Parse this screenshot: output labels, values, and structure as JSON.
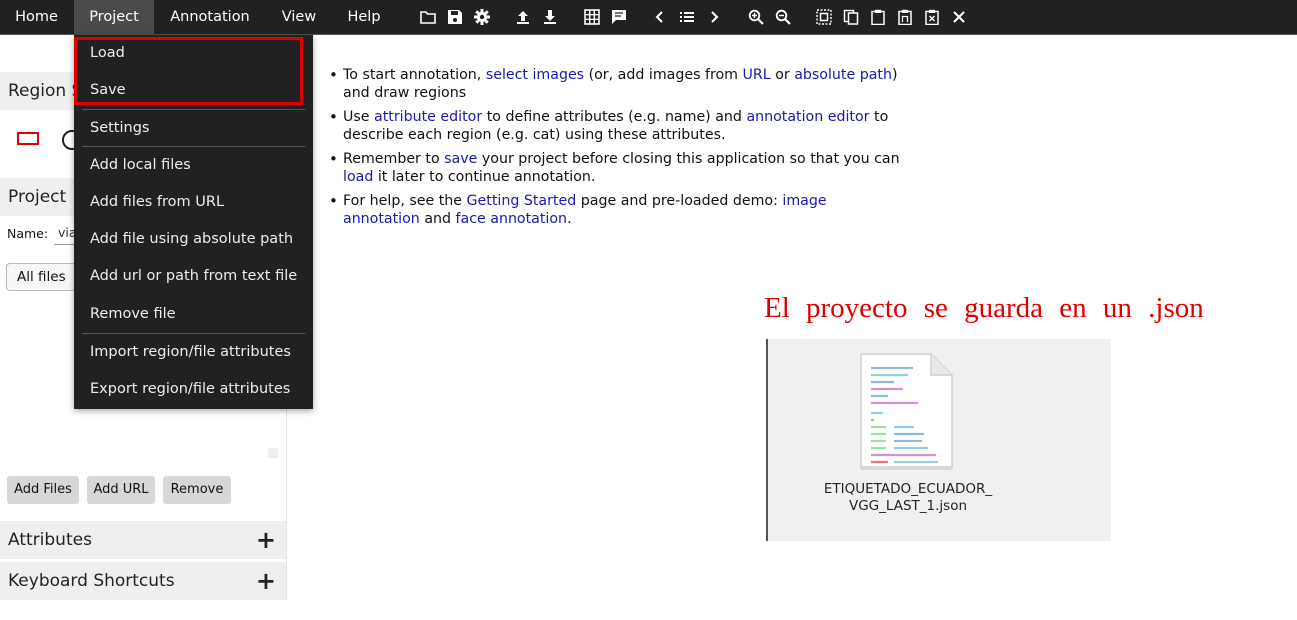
{
  "menubar": {
    "menus": [
      "Home",
      "Project",
      "Annotation",
      "View",
      "Help"
    ],
    "tools": [
      "folder-open-icon",
      "save-icon",
      "settings-icon",
      "upload-icon",
      "download-icon",
      "grid-icon",
      "comment-icon",
      "chevron-left-icon",
      "list-icon",
      "chevron-right-icon",
      "zoom-in-icon",
      "zoom-out-icon",
      "select-all-icon",
      "copy-icon",
      "paste-icon",
      "paste-special-icon",
      "delete-icon",
      "close-icon"
    ]
  },
  "sidebar": {
    "region_shape_title": "Region S",
    "project_title": "Project",
    "name_label": "Name:",
    "name_value": "via",
    "filter_value": "All files",
    "buttons": [
      "Add Files",
      "Add URL",
      "Remove"
    ],
    "attributes_title": "Attributes",
    "shortcuts_title": "Keyboard Shortcuts",
    "plus": "+"
  },
  "dropdown": {
    "items": [
      "Load",
      "Save",
      "Settings",
      "Add local files",
      "Add files from URL",
      "Add file using absolute path",
      "Add url or path from text file",
      "Remove file",
      "Import region/file attributes",
      "Export region/file attributes"
    ]
  },
  "help": {
    "b1": {
      "t1": "To start annotation,",
      "l1": "select images",
      "t2": "(or, add images from",
      "l2": "URL",
      "t3": "or",
      "l3": "absolute path",
      "t4": ") and draw regions"
    },
    "b2": {
      "t1": "Use",
      "l1": "attribute editor",
      "t2": "to define attributes (e.g. name) and",
      "l2": "annotation editor",
      "t3": "to describe each region (e.g. cat) using these attributes."
    },
    "b3": {
      "t1": "Remember to",
      "l1": "save",
      "t2": "your project before closing this application so that you can",
      "l2": "load",
      "t3": "it later to continue annotation."
    },
    "b4": {
      "t1": "For help, see the",
      "l1": "Getting Started",
      "t2": "page and pre-loaded demo:",
      "l2": "image annotation",
      "t3": "and",
      "l3": "face annotation",
      "t4": "."
    }
  },
  "note": "El proyecto se guarda en un .json",
  "file": {
    "name_line1": "ETIQUETADO_ECUADOR_",
    "name_line2": "VGG_LAST_1.json"
  }
}
